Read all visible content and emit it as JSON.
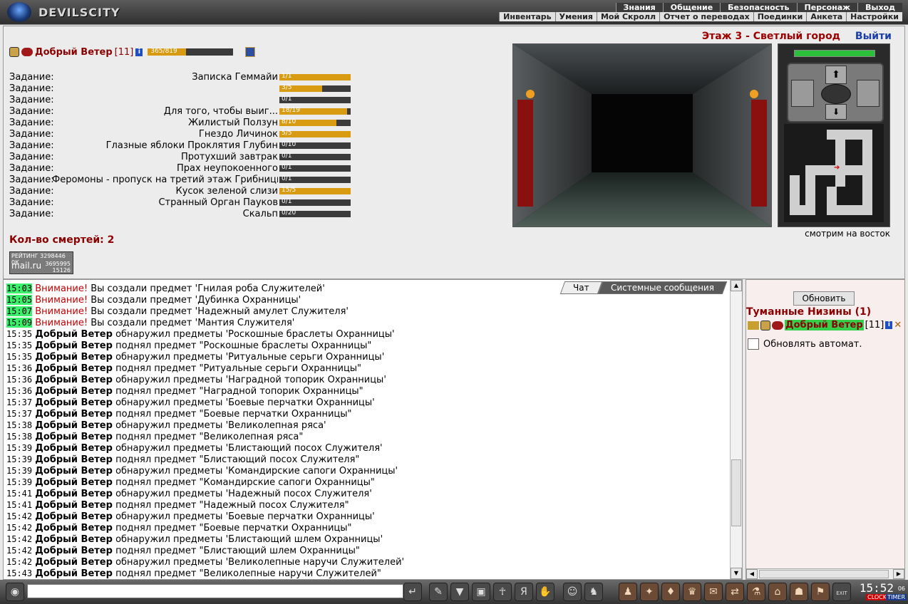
{
  "header": {
    "logo_text": "DEVILSCITY",
    "nav_top": [
      "Знания",
      "Общение",
      "Безопасность",
      "Персонаж",
      "Выход"
    ],
    "nav_sub": [
      "Инвентарь",
      "Умения",
      "Мой Скролл",
      "Отчет о переводах",
      "Поединки",
      "Анкета",
      "Настройки"
    ]
  },
  "location": {
    "floor_title": "Этаж 3 - Светлый город",
    "exit_label": "Выйти",
    "facing": "смотрим на восток"
  },
  "character": {
    "name": "Добрый Ветер",
    "level": "[11]",
    "info": "i",
    "hp_text": "365/819",
    "hp_fraction": 0.446
  },
  "quests": [
    {
      "label": "Задание:",
      "name": "Записка Геммайи",
      "progress": "1/1",
      "fraction": 1.0
    },
    {
      "label": "Задание:",
      "name": "",
      "progress": "3/5",
      "fraction": 0.6
    },
    {
      "label": "Задание:",
      "name": "",
      "progress": "0/1",
      "fraction": 0.0
    },
    {
      "label": "Задание:",
      "name": "Для того, чтобы выиг...",
      "progress": "18/19",
      "fraction": 0.947
    },
    {
      "label": "Задание:",
      "name": "Жилистый Ползун",
      "progress": "8/10",
      "fraction": 0.8
    },
    {
      "label": "Задание:",
      "name": "Гнездо Личинок",
      "progress": "5/5",
      "fraction": 1.0
    },
    {
      "label": "Задание:",
      "name": "Глазные яблоки Проклятия Глубин",
      "progress": "0/10",
      "fraction": 0.0
    },
    {
      "label": "Задание:",
      "name": "Протухший завтрак",
      "progress": "0/1",
      "fraction": 0.0
    },
    {
      "label": "Задание:",
      "name": "Прах неупокоенного",
      "progress": "0/1",
      "fraction": 0.0
    },
    {
      "label": "Задание:",
      "name": "Феромоны - пропуск на третий этаж Грибницы.",
      "progress": "0/1",
      "fraction": 0.0
    },
    {
      "label": "Задание:",
      "name": "Кусок зеленой слизи",
      "progress": "15/5",
      "fraction": 1.0
    },
    {
      "label": "Задание:",
      "name": "Странный Орган Пауков",
      "progress": "0/1",
      "fraction": 0.0
    },
    {
      "label": "Задание:",
      "name": "Скальп",
      "progress": "0/20",
      "fraction": 0.0
    }
  ],
  "deaths_label": "Кол-во смертей: 2",
  "rating": {
    "line1": "РЕЙТИНГ 3298446 0К",
    "brand": "mail.ru",
    "num1": "3695995",
    "num2": "15126"
  },
  "chat": {
    "tab_chat": "Чат",
    "tab_system": "Системные сообщения",
    "messages": [
      {
        "time": "15:03",
        "hl": true,
        "user": "",
        "warn": "Внимание!",
        "text": " Вы создали предмет 'Гнилая роба Служителей'"
      },
      {
        "time": "15:05",
        "hl": true,
        "user": "",
        "warn": "Внимание!",
        "text": " Вы создали предмет 'Дубинка Охранницы'"
      },
      {
        "time": "15:07",
        "hl": true,
        "user": "",
        "warn": "Внимание!",
        "text": " Вы создали предмет 'Надежный амулет Служителя'"
      },
      {
        "time": "15:09",
        "hl": true,
        "user": "",
        "warn": "Внимание!",
        "text": " Вы создали предмет 'Мантия Служителя'"
      },
      {
        "time": "15:35",
        "hl": false,
        "user": "Добрый Ветер",
        "warn": "",
        "text": " обнаружил предметы 'Роскошные браслеты Охранницы'"
      },
      {
        "time": "15:35",
        "hl": false,
        "user": "Добрый Ветер",
        "warn": "",
        "text": " поднял предмет \"Роскошные браслеты Охранницы\""
      },
      {
        "time": "15:35",
        "hl": false,
        "user": "Добрый Ветер",
        "warn": "",
        "text": " обнаружил предметы 'Ритуальные серьги Охранницы'"
      },
      {
        "time": "15:36",
        "hl": false,
        "user": "Добрый Ветер",
        "warn": "",
        "text": " поднял предмет \"Ритуальные серьги Охранницы\""
      },
      {
        "time": "15:36",
        "hl": false,
        "user": "Добрый Ветер",
        "warn": "",
        "text": " обнаружил предметы 'Наградной топорик Охранницы'"
      },
      {
        "time": "15:36",
        "hl": false,
        "user": "Добрый Ветер",
        "warn": "",
        "text": " поднял предмет \"Наградной топорик Охранницы\""
      },
      {
        "time": "15:37",
        "hl": false,
        "user": "Добрый Ветер",
        "warn": "",
        "text": " обнаружил предметы 'Боевые перчатки Охранницы'"
      },
      {
        "time": "15:37",
        "hl": false,
        "user": "Добрый Ветер",
        "warn": "",
        "text": " поднял предмет \"Боевые перчатки Охранницы\""
      },
      {
        "time": "15:38",
        "hl": false,
        "user": "Добрый Ветер",
        "warn": "",
        "text": " обнаружил предметы 'Великолепная ряса'"
      },
      {
        "time": "15:38",
        "hl": false,
        "user": "Добрый Ветер",
        "warn": "",
        "text": " поднял предмет \"Великолепная ряса\""
      },
      {
        "time": "15:39",
        "hl": false,
        "user": "Добрый Ветер",
        "warn": "",
        "text": " обнаружил предметы 'Блистающий посох Служителя'"
      },
      {
        "time": "15:39",
        "hl": false,
        "user": "Добрый Ветер",
        "warn": "",
        "text": " поднял предмет \"Блистающий посох Служителя\""
      },
      {
        "time": "15:39",
        "hl": false,
        "user": "Добрый Ветер",
        "warn": "",
        "text": " обнаружил предметы 'Командирские сапоги Охранницы'"
      },
      {
        "time": "15:39",
        "hl": false,
        "user": "Добрый Ветер",
        "warn": "",
        "text": " поднял предмет \"Командирские сапоги Охранницы\""
      },
      {
        "time": "15:41",
        "hl": false,
        "user": "Добрый Ветер",
        "warn": "",
        "text": " обнаружил предметы 'Надежный посох Служителя'"
      },
      {
        "time": "15:41",
        "hl": false,
        "user": "Добрый Ветер",
        "warn": "",
        "text": " поднял предмет \"Надежный посох Служителя\""
      },
      {
        "time": "15:42",
        "hl": false,
        "user": "Добрый Ветер",
        "warn": "",
        "text": " обнаружил предметы 'Боевые перчатки Охранницы'"
      },
      {
        "time": "15:42",
        "hl": false,
        "user": "Добрый Ветер",
        "warn": "",
        "text": " поднял предмет \"Боевые перчатки Охранницы\""
      },
      {
        "time": "15:42",
        "hl": false,
        "user": "Добрый Ветер",
        "warn": "",
        "text": " обнаружил предметы 'Блистающий шлем Охранницы'"
      },
      {
        "time": "15:42",
        "hl": false,
        "user": "Добрый Ветер",
        "warn": "",
        "text": " поднял предмет \"Блистающий шлем Охранницы\""
      },
      {
        "time": "15:42",
        "hl": false,
        "user": "Добрый Ветер",
        "warn": "",
        "text": " обнаружил предметы 'Великолепные наручи Служителей'"
      },
      {
        "time": "15:43",
        "hl": false,
        "user": "Добрый Ветер",
        "warn": "",
        "text": " поднял предмет \"Великолепные наручи Служителей\""
      }
    ]
  },
  "right_panel": {
    "refresh_label": "Обновить",
    "location_name": "Туманные Низины (1)",
    "online_name": "Добрый Ветер",
    "online_level": "[11]",
    "auto_refresh_label": "Обновлять автомат."
  },
  "bottom": {
    "clock": "15:52",
    "clock_seconds": "06",
    "clock_label": "CLOCK",
    "timer_label": "TIMER",
    "exit_badge": "EXIT"
  },
  "colors": {
    "accent_red": "#8b0000",
    "hp_gold": "#d79a10",
    "online_green": "#33d04a",
    "link_blue": "#1b3fa8"
  }
}
